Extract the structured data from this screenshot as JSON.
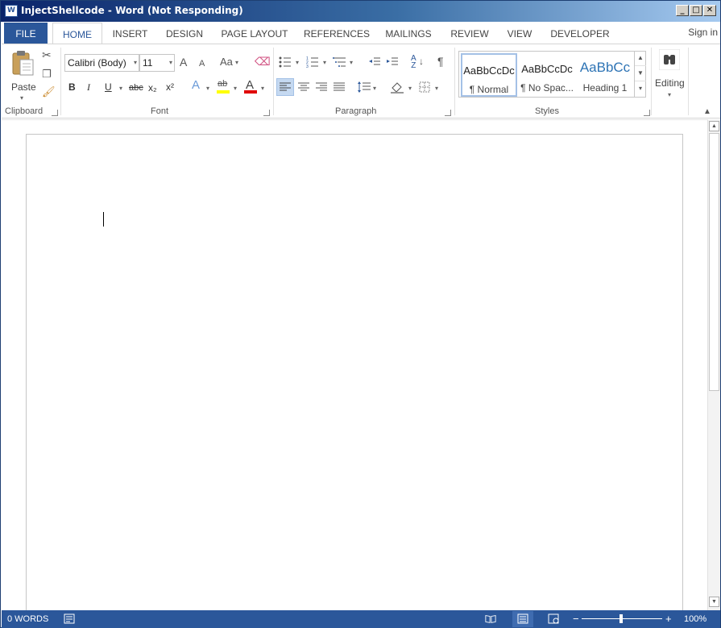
{
  "window": {
    "app_icon": "W",
    "title": "InjectShellcode - Word (Not Responding)",
    "minimize": "_",
    "maximize": "□",
    "close": "✕"
  },
  "tabs": {
    "file": "FILE",
    "home": "HOME",
    "insert": "INSERT",
    "design": "DESIGN",
    "page_layout": "PAGE LAYOUT",
    "references": "REFERENCES",
    "mailings": "MAILINGS",
    "review": "REVIEW",
    "view": "VIEW",
    "developer": "DEVELOPER",
    "sign_in": "Sign in"
  },
  "clipboard": {
    "paste": "Paste",
    "label": "Clipboard"
  },
  "font": {
    "family": "Calibri (Body)",
    "size": "11",
    "grow": "A",
    "shrink": "A",
    "case": "Aa",
    "bold": "B",
    "italic": "I",
    "underline": "U",
    "strike": "abc",
    "subscript": "x₂",
    "superscript": "x²",
    "effects": "A",
    "highlight": "ab",
    "color": "A",
    "label": "Font"
  },
  "paragraph": {
    "show_marks": "¶",
    "label": "Paragraph"
  },
  "styles": {
    "items": [
      {
        "sample": "AaBbCcDc",
        "name": "¶ Normal"
      },
      {
        "sample": "AaBbCcDc",
        "name": "¶ No Spac..."
      },
      {
        "sample": "AaBbCc",
        "name": "Heading 1"
      }
    ],
    "label": "Styles"
  },
  "editing": {
    "label": "Editing"
  },
  "status": {
    "words": "0 WORDS",
    "zoom_minus": "−",
    "zoom_plus": "+",
    "zoom": "100%",
    "zoom_level": 1.0
  },
  "colors": {
    "word_blue": "#2b579a",
    "highlight_yellow": "#ffff00",
    "font_red": "#e00000",
    "heading_blue": "#2e74b5"
  }
}
